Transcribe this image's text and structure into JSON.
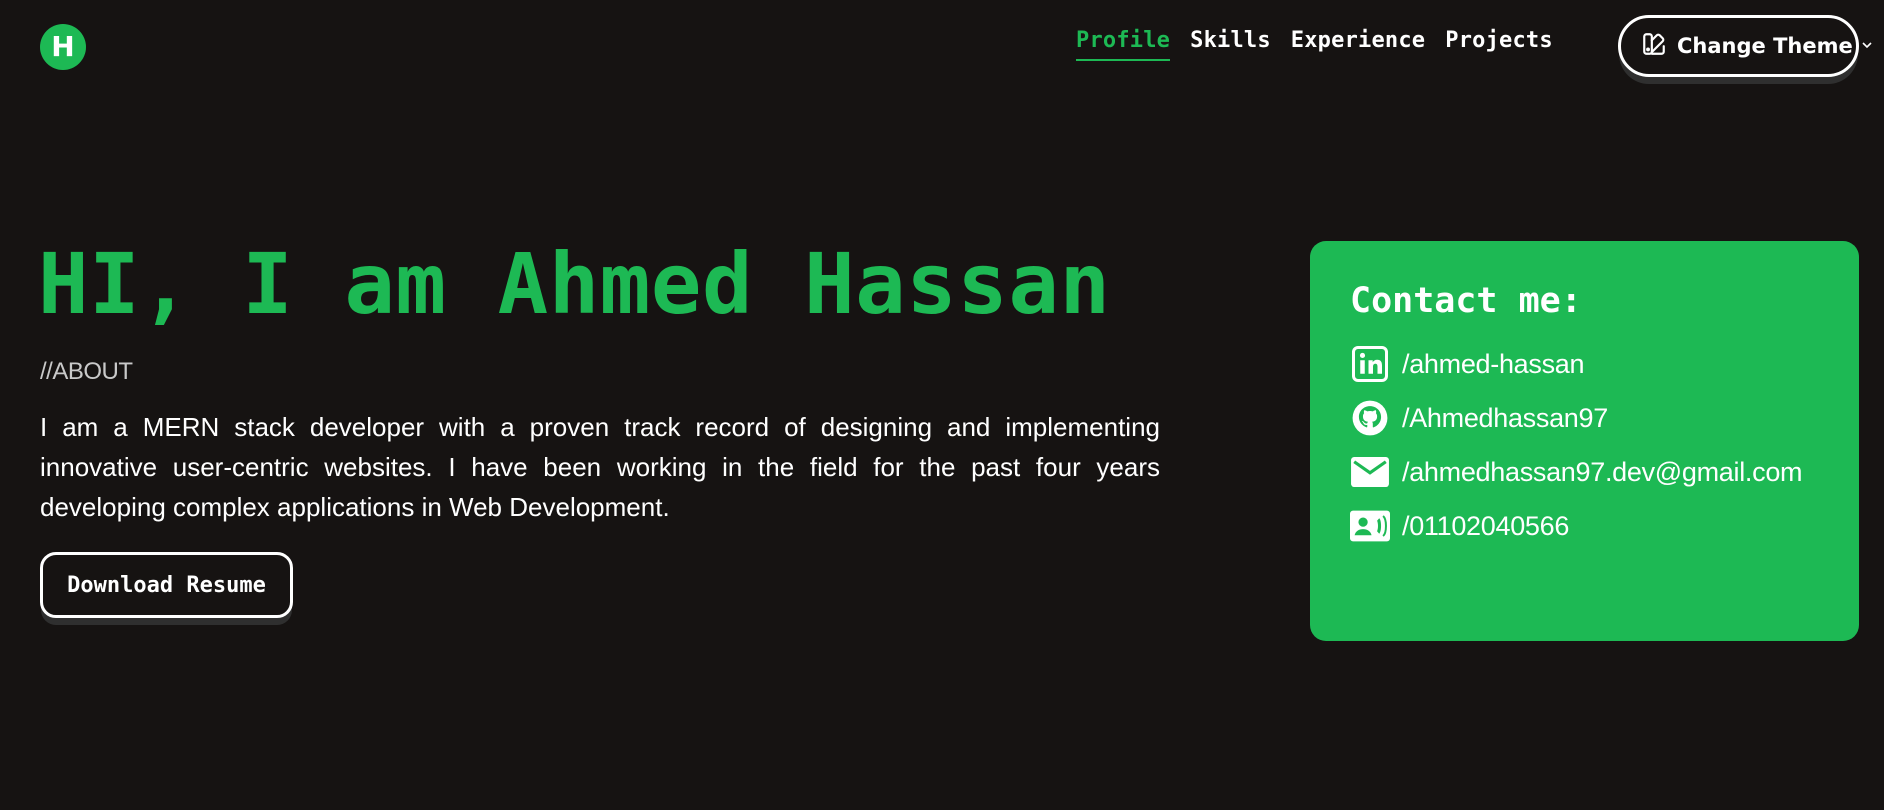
{
  "header": {
    "logo_letter": "H",
    "nav": [
      {
        "label": "Profile",
        "active": true
      },
      {
        "label": "Skills",
        "active": false
      },
      {
        "label": "Experience",
        "active": false
      },
      {
        "label": "Projects",
        "active": false
      }
    ],
    "theme_button_label": "Change Theme",
    "theme_button_icon": "palette-icon",
    "theme_button_chevron": "chevron-down-icon"
  },
  "hero": {
    "title": "HI, I am Ahmed Hassan",
    "about_label": "//ABOUT",
    "about_text": "I am a MERN stack developer with a proven track record of designing and implementing innovative user-centric websites. I have been working in the field for the past four years developing complex applications in Web Development.",
    "resume_button": "Download Resume"
  },
  "contact": {
    "title": "Contact me:",
    "items": [
      {
        "icon": "linkedin-icon",
        "text": "/ahmed-hassan"
      },
      {
        "icon": "github-icon",
        "text": "/Ahmedhassan97"
      },
      {
        "icon": "mail-icon",
        "text": "/ahmedhassan97.dev@gmail.com"
      },
      {
        "icon": "contact-card-icon",
        "text": "/01102040566"
      }
    ]
  },
  "colors": {
    "background": "#161312",
    "accent": "#1db954",
    "text": "#ffffff"
  }
}
